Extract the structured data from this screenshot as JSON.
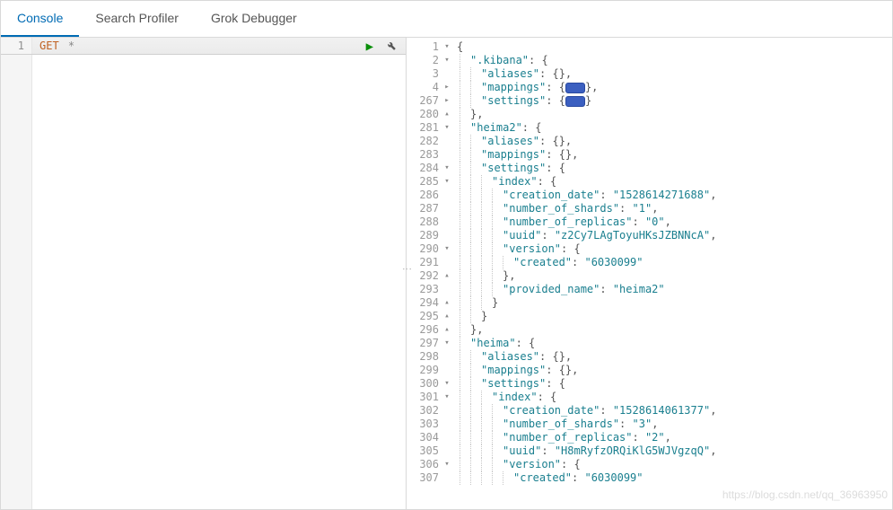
{
  "tabs": {
    "console": "Console",
    "search_profiler": "Search Profiler",
    "grok_debugger": "Grok Debugger"
  },
  "request": {
    "line_no": "1",
    "method": "GET",
    "path": "*"
  },
  "response_lines": [
    {
      "no": "1",
      "fold": "d",
      "ind": 0,
      "t": [
        {
          "c": "p",
          "v": "{"
        }
      ]
    },
    {
      "no": "2",
      "fold": "d",
      "ind": 1,
      "t": [
        {
          "c": "k",
          "v": "\".kibana\""
        },
        {
          "c": "p",
          "v": ": {"
        }
      ]
    },
    {
      "no": "3",
      "fold": "",
      "ind": 2,
      "t": [
        {
          "c": "k",
          "v": "\"aliases\""
        },
        {
          "c": "p",
          "v": ": {},"
        }
      ]
    },
    {
      "no": "4",
      "fold": "r",
      "ind": 2,
      "t": [
        {
          "c": "k",
          "v": "\"mappings\""
        },
        {
          "c": "p",
          "v": ": {"
        },
        {
          "badge": true
        },
        {
          "c": "p",
          "v": "},"
        }
      ]
    },
    {
      "no": "267",
      "fold": "r",
      "ind": 2,
      "t": [
        {
          "c": "k",
          "v": "\"settings\""
        },
        {
          "c": "p",
          "v": ": {"
        },
        {
          "badge": true
        },
        {
          "c": "p",
          "v": "}"
        }
      ]
    },
    {
      "no": "280",
      "fold": "u",
      "ind": 1,
      "t": [
        {
          "c": "p",
          "v": "},"
        }
      ]
    },
    {
      "no": "281",
      "fold": "d",
      "ind": 1,
      "t": [
        {
          "c": "k",
          "v": "\"heima2\""
        },
        {
          "c": "p",
          "v": ": {"
        }
      ]
    },
    {
      "no": "282",
      "fold": "",
      "ind": 2,
      "t": [
        {
          "c": "k",
          "v": "\"aliases\""
        },
        {
          "c": "p",
          "v": ": {},"
        }
      ]
    },
    {
      "no": "283",
      "fold": "",
      "ind": 2,
      "t": [
        {
          "c": "k",
          "v": "\"mappings\""
        },
        {
          "c": "p",
          "v": ": {},"
        }
      ]
    },
    {
      "no": "284",
      "fold": "d",
      "ind": 2,
      "t": [
        {
          "c": "k",
          "v": "\"settings\""
        },
        {
          "c": "p",
          "v": ": {"
        }
      ]
    },
    {
      "no": "285",
      "fold": "d",
      "ind": 3,
      "t": [
        {
          "c": "k",
          "v": "\"index\""
        },
        {
          "c": "p",
          "v": ": {"
        }
      ]
    },
    {
      "no": "286",
      "fold": "",
      "ind": 4,
      "t": [
        {
          "c": "k",
          "v": "\"creation_date\""
        },
        {
          "c": "p",
          "v": ": "
        },
        {
          "c": "sv",
          "v": "\"1528614271688\""
        },
        {
          "c": "p",
          "v": ","
        }
      ]
    },
    {
      "no": "287",
      "fold": "",
      "ind": 4,
      "t": [
        {
          "c": "k",
          "v": "\"number_of_shards\""
        },
        {
          "c": "p",
          "v": ": "
        },
        {
          "c": "sv",
          "v": "\"1\""
        },
        {
          "c": "p",
          "v": ","
        }
      ]
    },
    {
      "no": "288",
      "fold": "",
      "ind": 4,
      "t": [
        {
          "c": "k",
          "v": "\"number_of_replicas\""
        },
        {
          "c": "p",
          "v": ": "
        },
        {
          "c": "sv",
          "v": "\"0\""
        },
        {
          "c": "p",
          "v": ","
        }
      ]
    },
    {
      "no": "289",
      "fold": "",
      "ind": 4,
      "t": [
        {
          "c": "k",
          "v": "\"uuid\""
        },
        {
          "c": "p",
          "v": ": "
        },
        {
          "c": "sv",
          "v": "\"z2Cy7LAgToyuHKsJZBNNcA\""
        },
        {
          "c": "p",
          "v": ","
        }
      ]
    },
    {
      "no": "290",
      "fold": "d",
      "ind": 4,
      "t": [
        {
          "c": "k",
          "v": "\"version\""
        },
        {
          "c": "p",
          "v": ": {"
        }
      ]
    },
    {
      "no": "291",
      "fold": "",
      "ind": 5,
      "t": [
        {
          "c": "k",
          "v": "\"created\""
        },
        {
          "c": "p",
          "v": ": "
        },
        {
          "c": "sv",
          "v": "\"6030099\""
        }
      ]
    },
    {
      "no": "292",
      "fold": "u",
      "ind": 4,
      "t": [
        {
          "c": "p",
          "v": "},"
        }
      ]
    },
    {
      "no": "293",
      "fold": "",
      "ind": 4,
      "t": [
        {
          "c": "k",
          "v": "\"provided_name\""
        },
        {
          "c": "p",
          "v": ": "
        },
        {
          "c": "sv",
          "v": "\"heima2\""
        }
      ]
    },
    {
      "no": "294",
      "fold": "u",
      "ind": 3,
      "t": [
        {
          "c": "p",
          "v": "}"
        }
      ]
    },
    {
      "no": "295",
      "fold": "u",
      "ind": 2,
      "t": [
        {
          "c": "p",
          "v": "}"
        }
      ]
    },
    {
      "no": "296",
      "fold": "u",
      "ind": 1,
      "t": [
        {
          "c": "p",
          "v": "},"
        }
      ]
    },
    {
      "no": "297",
      "fold": "d",
      "ind": 1,
      "t": [
        {
          "c": "k",
          "v": "\"heima\""
        },
        {
          "c": "p",
          "v": ": {"
        }
      ]
    },
    {
      "no": "298",
      "fold": "",
      "ind": 2,
      "t": [
        {
          "c": "k",
          "v": "\"aliases\""
        },
        {
          "c": "p",
          "v": ": {},"
        }
      ]
    },
    {
      "no": "299",
      "fold": "",
      "ind": 2,
      "t": [
        {
          "c": "k",
          "v": "\"mappings\""
        },
        {
          "c": "p",
          "v": ": {},"
        }
      ]
    },
    {
      "no": "300",
      "fold": "d",
      "ind": 2,
      "t": [
        {
          "c": "k",
          "v": "\"settings\""
        },
        {
          "c": "p",
          "v": ": {"
        }
      ]
    },
    {
      "no": "301",
      "fold": "d",
      "ind": 3,
      "t": [
        {
          "c": "k",
          "v": "\"index\""
        },
        {
          "c": "p",
          "v": ": {"
        }
      ]
    },
    {
      "no": "302",
      "fold": "",
      "ind": 4,
      "t": [
        {
          "c": "k",
          "v": "\"creation_date\""
        },
        {
          "c": "p",
          "v": ": "
        },
        {
          "c": "sv",
          "v": "\"1528614061377\""
        },
        {
          "c": "p",
          "v": ","
        }
      ]
    },
    {
      "no": "303",
      "fold": "",
      "ind": 4,
      "t": [
        {
          "c": "k",
          "v": "\"number_of_shards\""
        },
        {
          "c": "p",
          "v": ": "
        },
        {
          "c": "sv",
          "v": "\"3\""
        },
        {
          "c": "p",
          "v": ","
        }
      ]
    },
    {
      "no": "304",
      "fold": "",
      "ind": 4,
      "t": [
        {
          "c": "k",
          "v": "\"number_of_replicas\""
        },
        {
          "c": "p",
          "v": ": "
        },
        {
          "c": "sv",
          "v": "\"2\""
        },
        {
          "c": "p",
          "v": ","
        }
      ]
    },
    {
      "no": "305",
      "fold": "",
      "ind": 4,
      "t": [
        {
          "c": "k",
          "v": "\"uuid\""
        },
        {
          "c": "p",
          "v": ": "
        },
        {
          "c": "sv",
          "v": "\"H8mRyfzORQiKlG5WJVgzqQ\""
        },
        {
          "c": "p",
          "v": ","
        }
      ]
    },
    {
      "no": "306",
      "fold": "d",
      "ind": 4,
      "t": [
        {
          "c": "k",
          "v": "\"version\""
        },
        {
          "c": "p",
          "v": ": {"
        }
      ]
    },
    {
      "no": "307",
      "fold": "",
      "ind": 5,
      "t": [
        {
          "c": "k",
          "v": "\"created\""
        },
        {
          "c": "p",
          "v": ": "
        },
        {
          "c": "sv",
          "v": "\"6030099\""
        }
      ]
    }
  ],
  "watermark": "https://blog.csdn.net/qq_36963950"
}
